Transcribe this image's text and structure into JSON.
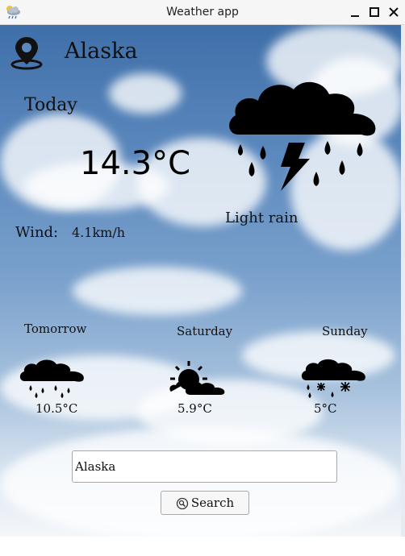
{
  "window": {
    "title": "Weather app"
  },
  "current": {
    "location": "Alaska",
    "day": "Today",
    "temperature": "14.3°C",
    "description": "Light rain",
    "wind_label": "Wind:",
    "wind_value": "4.1km/h",
    "icon": "thunderstorm-rain-icon"
  },
  "forecast": [
    {
      "day": "Tomorrow",
      "temperature": "10.5°C",
      "icon": "rain-cloud-icon"
    },
    {
      "day": "Saturday",
      "temperature": "5.9°C",
      "icon": "partly-sunny-icon"
    },
    {
      "day": "Sunday",
      "temperature": "5°C",
      "icon": "sleet-cloud-icon"
    }
  ],
  "search": {
    "value": "Alaska",
    "button_label": "Search"
  },
  "colors": {
    "sky_top": "#3f6fa9",
    "sky_bottom": "#f4f7fa",
    "icon": "#000000"
  }
}
